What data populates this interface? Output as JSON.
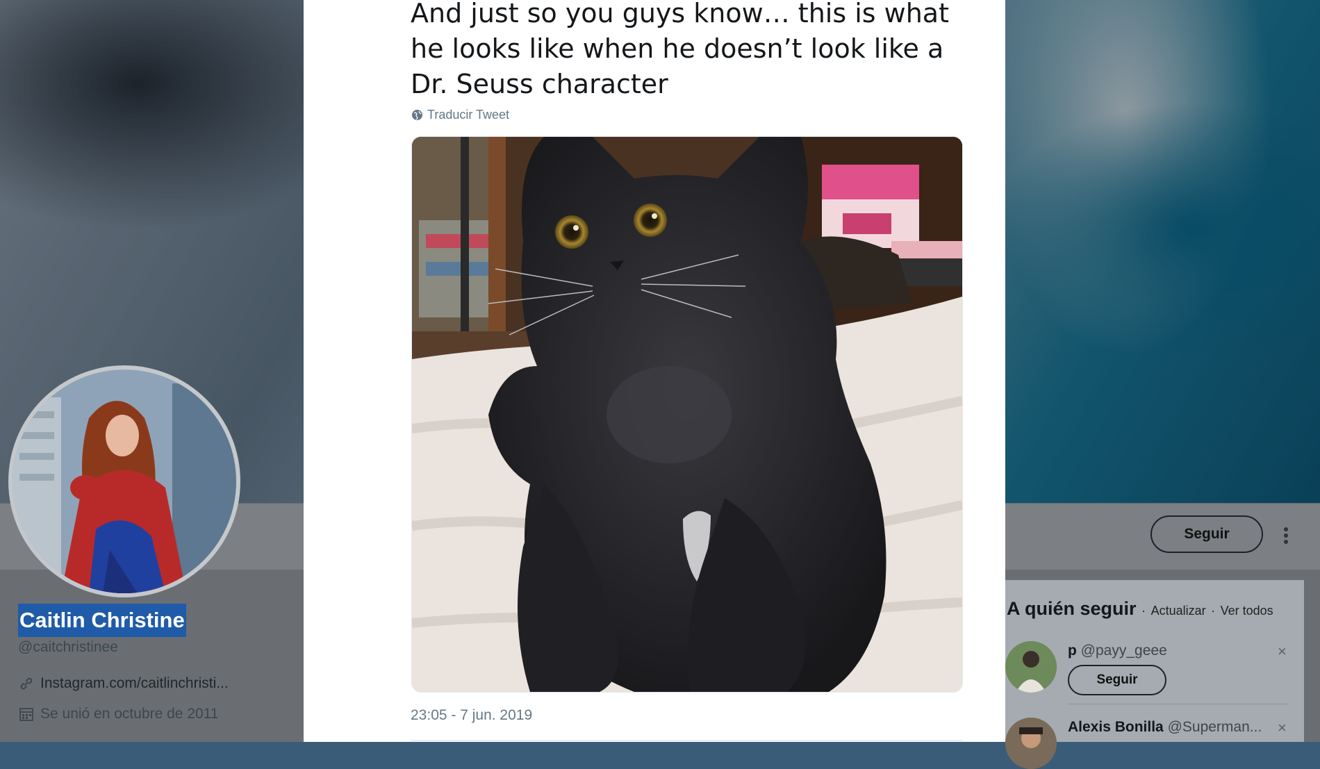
{
  "profile": {
    "name": "Caitlin Christine",
    "handle": "@caitchristinee",
    "link": "Instagram.com/caitlinchristi...",
    "joined": "Se unió en octubre de 2011"
  },
  "tweet": {
    "text": "And just so you guys know… this is what he looks like when he doesn’t look like a Dr. Seuss character",
    "translate_label": "Traducir Tweet",
    "timestamp": "23:05 - 7 jun. 2019"
  },
  "header": {
    "follow_label": "Seguir"
  },
  "who_to_follow": {
    "title": "A quién seguir",
    "refresh": "Actualizar",
    "view_all": "Ver todos",
    "separator": "·",
    "users": [
      {
        "name": "p",
        "handle": "@payy_geee",
        "follow_label": "Seguir",
        "close": "×"
      },
      {
        "name": "Alexis Bonilla",
        "handle": "@Superman...",
        "close": "×"
      }
    ]
  },
  "colors": {
    "selection": "#1f5ba8",
    "banner_accent": "#0b6f94"
  }
}
